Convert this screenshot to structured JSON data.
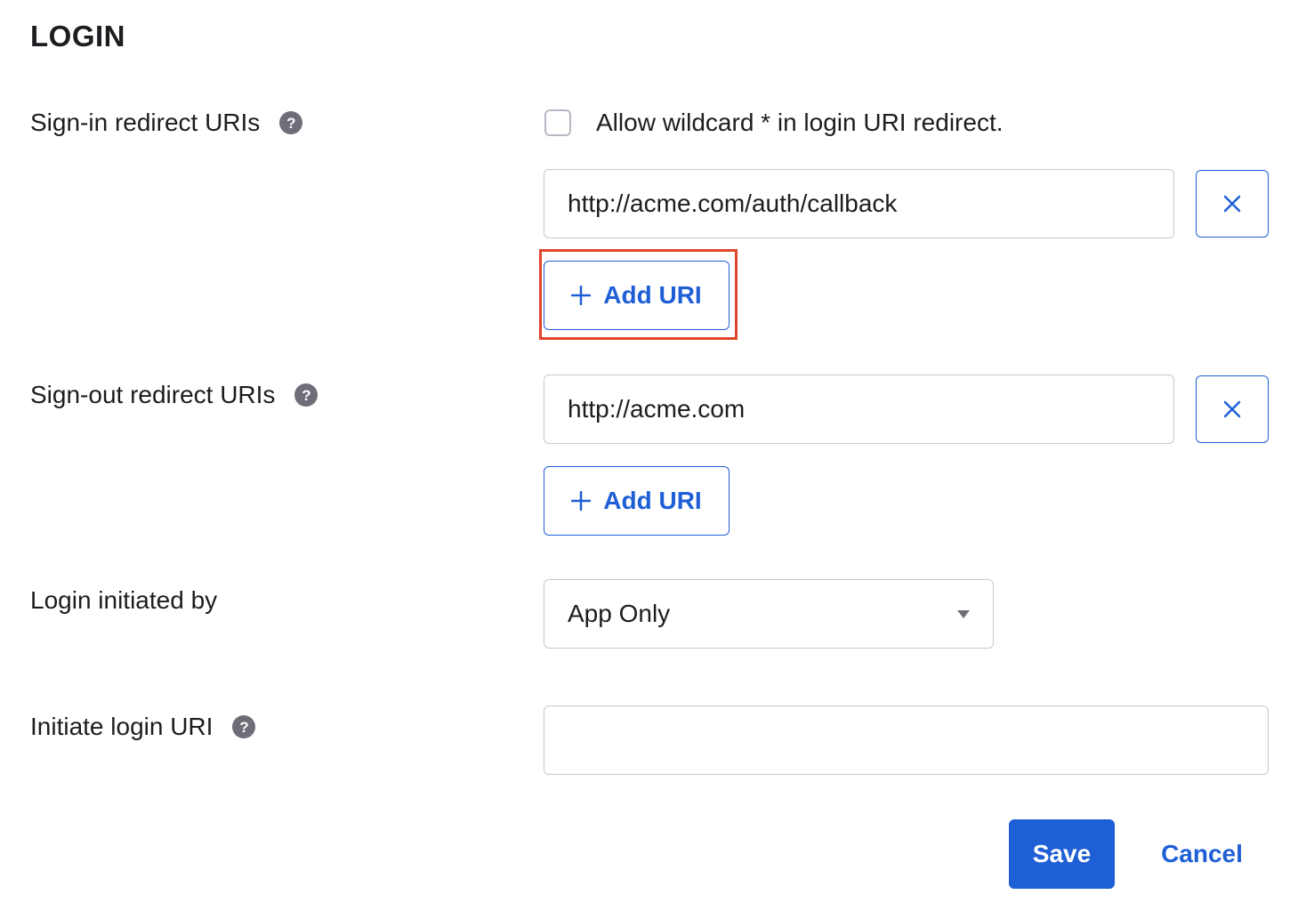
{
  "section": {
    "title": "LOGIN"
  },
  "signin": {
    "label": "Sign-in redirect URIs",
    "help_icon": "question-circle-icon",
    "wildcard_label": "Allow wildcard * in login URI redirect.",
    "wildcard_checked": false,
    "uris": [
      "http://acme.com/auth/callback"
    ],
    "remove_icon": "close-icon",
    "add_label": "Add URI",
    "add_icon": "plus-icon"
  },
  "signout": {
    "label": "Sign-out redirect URIs",
    "help_icon": "question-circle-icon",
    "uris": [
      "http://acme.com"
    ],
    "remove_icon": "close-icon",
    "add_label": "Add URI",
    "add_icon": "plus-icon"
  },
  "login_initiated": {
    "label": "Login initiated by",
    "selected": "App Only",
    "dropdown_icon": "caret-down-icon"
  },
  "initiate_uri": {
    "label": "Initiate login URI",
    "help_icon": "question-circle-icon",
    "value": ""
  },
  "actions": {
    "save_label": "Save",
    "cancel_label": "Cancel"
  },
  "colors": {
    "accent": "#1f5fd6",
    "highlight": "#e0452b",
    "text": "#1d1d21",
    "border": "#c6c8ce"
  }
}
